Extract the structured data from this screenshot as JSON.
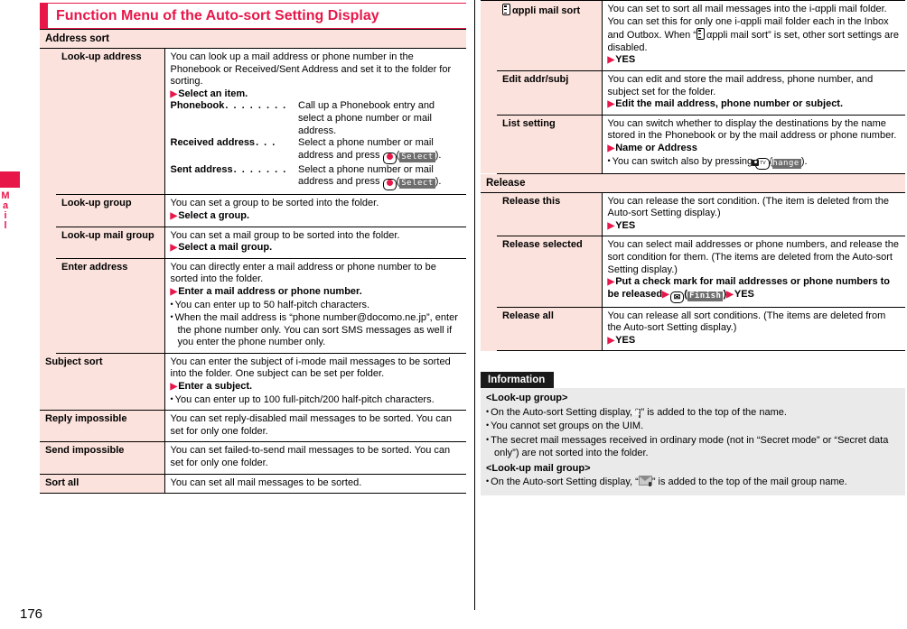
{
  "page": {
    "number": "176",
    "side_tab_label": "Mail",
    "accent_color": "#e8174a",
    "label_cell_bg": "#fbe2dc",
    "info_bg": "#eaeaea"
  },
  "chapter": {
    "title": "Function Menu of the Auto-sort Setting Display"
  },
  "left_column": {
    "section": {
      "label": "Address sort"
    },
    "rows": [
      {
        "name": "Look-up address",
        "desc_intro": "You can look up a mail address or phone number in the Phonebook or Received/Sent Address and set it to the folder for sorting.",
        "step": "Select an item.",
        "definitions": [
          {
            "term": "Phonebook",
            "desc": "Call up a Phonebook entry and select a phone number or mail address."
          },
          {
            "term": "Received address",
            "desc_pre": "Select a phone number or mail address and press",
            "key": "center-key",
            "softkey": "Select",
            "desc_post": "."
          },
          {
            "term": "Sent address",
            "desc_pre": "Select a phone number or mail address and press",
            "key": "center-key",
            "softkey": "Select",
            "desc_post": "."
          }
        ]
      },
      {
        "name": "Look-up group",
        "desc_intro": "You can set a group to be sorted into the folder.",
        "step": "Select a group."
      },
      {
        "name": "Look-up mail group",
        "desc_intro": "You can set a mail group to be sorted into the folder.",
        "step": "Select a mail group."
      },
      {
        "name": "Enter address",
        "desc_intro": "You can directly enter a mail address or phone number to be sorted into the folder.",
        "step": "Enter a mail address or phone number.",
        "bullets": [
          "You can enter up to 50 half-pitch characters.",
          "When the mail address is “phone number@docomo.ne.jp”, enter the phone number only. You can sort SMS messages as well if you enter the phone number only."
        ]
      },
      {
        "name": "Subject sort",
        "top_level": true,
        "desc_intro": "You can enter the subject of i-mode mail messages to be sorted into the folder. One subject can be set per folder.",
        "step": "Enter a subject.",
        "bullets": [
          "You can enter up to 100 full-pitch/200 half-pitch characters."
        ]
      },
      {
        "name": "Reply impossible",
        "top_level": true,
        "desc_intro": "You can set reply-disabled mail messages to be sorted. You can set for only one folder."
      },
      {
        "name": "Send impossible",
        "top_level": true,
        "desc_intro": "You can set failed-to-send mail messages to be sorted. You can set for only one folder."
      },
      {
        "name": "Sort all",
        "top_level": true,
        "desc_intro": "You can set all mail messages to be sorted."
      }
    ]
  },
  "right_column": {
    "rows": [
      {
        "name_icon": "iappli-phone-icon",
        "name": "αppli mail sort",
        "desc_part1": "You can set to sort all mail messages into the i-αppli mail folder. You can set this for only one i-αppli mail folder each in the Inbox and Outbox. When “",
        "desc_part2": "αppli mail sort” is set, other sort settings are disabled.",
        "step": "YES"
      },
      {
        "name": "Edit addr/subj",
        "desc_intro": "You can edit and store the mail address, phone number, and subject set for the folder.",
        "step": "Edit the mail address, phone number or subject."
      },
      {
        "name": "List setting",
        "desc_intro": "You can switch whether to display the destinations by the name stored in the Phonebook or by the mail address or phone number.",
        "step": "Name or Address",
        "bullet_pre": "You can switch also by pressing",
        "bullet_key": "camera-tv-key",
        "bullet_softkey": "Change",
        "bullet_post": "."
      }
    ],
    "release_section": {
      "label": "Release"
    },
    "release_rows": [
      {
        "name": "Release this",
        "desc_intro": "You can release the sort condition. (The item is deleted from the Auto-sort Setting display.)",
        "step": "YES"
      },
      {
        "name": "Release selected",
        "desc_intro": "You can select mail addresses or phone numbers, and release the sort condition for them. (The items are deleted from the Auto-sort Setting display.)",
        "step_part1": "Put a check mark for mail addresses or phone numbers to be released",
        "step_key": "mail-key",
        "step_softkey": "Finish",
        "step_part2": "YES"
      },
      {
        "name": "Release all",
        "desc_intro": "You can release all sort conditions. (The items are deleted from the Auto-sort Setting display.)",
        "step": "YES"
      }
    ],
    "information": {
      "tab_label": "Information",
      "heading1": "<Look-up group>",
      "item1_pre": "On the Auto-sort Setting display, “",
      "item1_badge": "GR",
      "item1_post": "” is added to the top of the name.",
      "item2": "You cannot set groups on the UIM.",
      "item3": "The secret mail messages received in ordinary mode (not in “Secret mode” or “Secret data only”) are not sorted into the folder.",
      "heading2": "<Look-up mail group>",
      "item4_pre": "On the Auto-sort Setting display, “",
      "item4_post": "” is added to the top of the mail group name."
    }
  }
}
